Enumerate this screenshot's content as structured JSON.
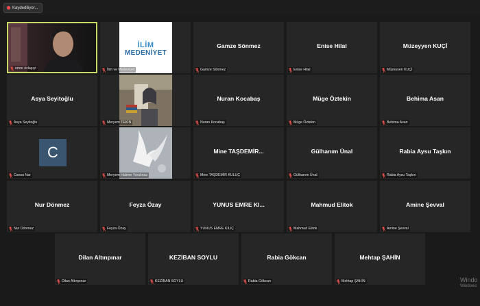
{
  "recording": {
    "label": "Kaydediliyor..."
  },
  "grid": {
    "rows": [
      [
        {
          "display_name": "",
          "label": "emre özlaşıyi",
          "media": "camera",
          "active": true
        },
        {
          "display_name": "",
          "label": "İlim ve Medeniyet",
          "media": "logo",
          "logo_line1": "İLİM",
          "logo_line2": "MEDENİYET"
        },
        {
          "display_name": "Gamze Sönmez",
          "label": "Gamze Sönmez"
        },
        {
          "display_name": "Enise Hilal",
          "label": "Enise Hilal"
        },
        {
          "display_name": "Müzeyyen KUÇİ",
          "label": "Müzeyyen KUÇİ"
        }
      ],
      [
        {
          "display_name": "Asya Seyitoğlu",
          "label": "Asya Seyitoğlu"
        },
        {
          "display_name": "",
          "label": "Meryem TEKİN",
          "media": "photo-reading"
        },
        {
          "display_name": "Nuran Kocabaş",
          "label": "Nuran Kocabaş"
        },
        {
          "display_name": "Müge Öztekin",
          "label": "Müge Öztekin"
        },
        {
          "display_name": "Behima Asan",
          "label": "Behima Asan"
        }
      ],
      [
        {
          "display_name": "",
          "label": "Cansu Nar",
          "media": "avatar",
          "avatar_letter": "C"
        },
        {
          "display_name": "",
          "label": "Meryem Halime Yorulmaz",
          "media": "photo-birds"
        },
        {
          "display_name": "Mine TAŞDEMİR...",
          "label": "Mine TAŞDEMİR KULUÇ"
        },
        {
          "display_name": "Gülhanım Ünal",
          "label": "Gülhanım Ünal"
        },
        {
          "display_name": "Rabia Aysu Taşkın",
          "label": "Rabia Aysu Taşkın"
        }
      ],
      [
        {
          "display_name": "Nur Dönmez",
          "label": "Nur Dönmez"
        },
        {
          "display_name": "Feyza Özay",
          "label": "Feyza Özay"
        },
        {
          "display_name": "YUNUS EMRE KI...",
          "label": "YUNUS EMRE KILIÇ"
        },
        {
          "display_name": "Mahmud Elitok",
          "label": "Mahmud Elitok"
        },
        {
          "display_name": "Amine Şevval",
          "label": "Amine Şevval"
        }
      ],
      [
        {
          "display_name": "Dilan Altınpınar",
          "label": "Dilan Altınpınar"
        },
        {
          "display_name": "KEZİBAN SOYLU",
          "label": "KEZİBAN SOYLU"
        },
        {
          "display_name": "Rabia Gökcan",
          "label": "Rabia Gökcan"
        },
        {
          "display_name": "Mehtap ŞAHİN",
          "label": "Mehtap ŞAHİN"
        }
      ]
    ]
  },
  "watermark": {
    "line1": "Windo",
    "line2": "Windows"
  },
  "colors": {
    "active_border": "#c8d96a",
    "tile_bg": "#262626",
    "muted_mic": "#e0504a"
  }
}
